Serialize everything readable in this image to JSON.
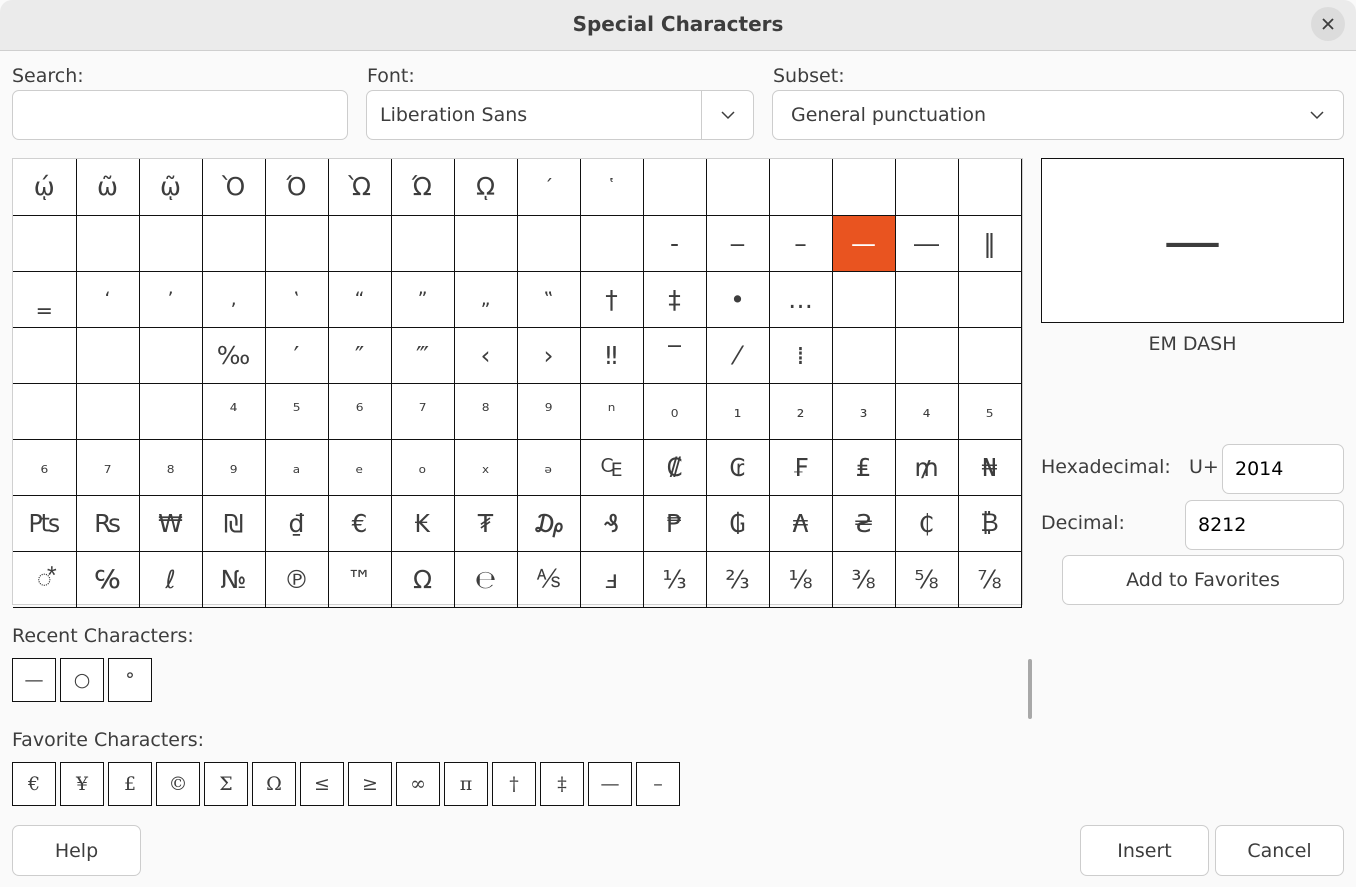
{
  "window": {
    "title": "Special Characters",
    "close_icon": "close-icon"
  },
  "search": {
    "label": "Search:",
    "value": "",
    "placeholder": ""
  },
  "font": {
    "label": "Font:",
    "value": "Liberation Sans"
  },
  "subset": {
    "label": "Subset:",
    "value": "General punctuation"
  },
  "grid": {
    "selected": {
      "row": 1,
      "col": 13
    },
    "rows": [
      [
        "ῴ",
        "ῶ",
        "ῷ",
        "Ὸ",
        "Ό",
        "Ὼ",
        "Ώ",
        "ῼ",
        "´",
        "῾",
        "",
        "",
        "",
        "",
        "",
        ""
      ],
      [
        "",
        "",
        "",
        "",
        "",
        "",
        "",
        "",
        "",
        "",
        "‑",
        "‒",
        "–",
        "—",
        "―",
        "‖"
      ],
      [
        "‗",
        "‘",
        "’",
        "‚",
        "‛",
        "“",
        "”",
        "„",
        "‟",
        "†",
        "‡",
        "•",
        "…",
        "",
        "",
        ""
      ],
      [
        "",
        "",
        "",
        "‰",
        "′",
        "″",
        "‴",
        "‹",
        "›",
        "‼",
        "‾",
        "⁄",
        "⁞",
        "",
        "",
        ""
      ],
      [
        "",
        "",
        "",
        "⁴",
        "⁵",
        "⁶",
        "⁷",
        "⁸",
        "⁹",
        "ⁿ",
        "₀",
        "₁",
        "₂",
        "₃",
        "₄",
        "₅"
      ],
      [
        "₆",
        "₇",
        "₈",
        "₉",
        "ₐ",
        "ₑ",
        "ₒ",
        "ₓ",
        "ₔ",
        "₠",
        "₡",
        "₢",
        "₣",
        "₤",
        "₥",
        "₦"
      ],
      [
        "₧",
        "₨",
        "₩",
        "₪",
        "₫",
        "€",
        "₭",
        "₮",
        "₯",
        "₰",
        "₱",
        "₲",
        "₳",
        "₴",
        "₵",
        "₿"
      ],
      [
        "◌⃰",
        "℅",
        "ℓ",
        "№",
        "℗",
        "™",
        "Ω",
        "℮",
        "⅍",
        "ⅎ",
        "⅓",
        "⅔",
        "⅛",
        "⅜",
        "⅝",
        "⅞"
      ]
    ]
  },
  "preview": {
    "char": "—",
    "name": "EM DASH"
  },
  "hex": {
    "label": "Hexadecimal:",
    "prefix": "U+",
    "value": "2014"
  },
  "decimal": {
    "label": "Decimal:",
    "value": "8212"
  },
  "add_favorites_label": "Add to Favorites",
  "recent": {
    "label": "Recent Characters:",
    "chars": [
      "—",
      "○",
      "°"
    ]
  },
  "favorites": {
    "label": "Favorite Characters:",
    "chars": [
      "€",
      "¥",
      "£",
      "©",
      "Σ",
      "Ω",
      "≤",
      "≥",
      "∞",
      "π",
      "†",
      "‡",
      "—",
      "–"
    ]
  },
  "buttons": {
    "help": "Help",
    "insert": "Insert",
    "cancel": "Cancel"
  },
  "colors": {
    "accent": "#e95420"
  }
}
